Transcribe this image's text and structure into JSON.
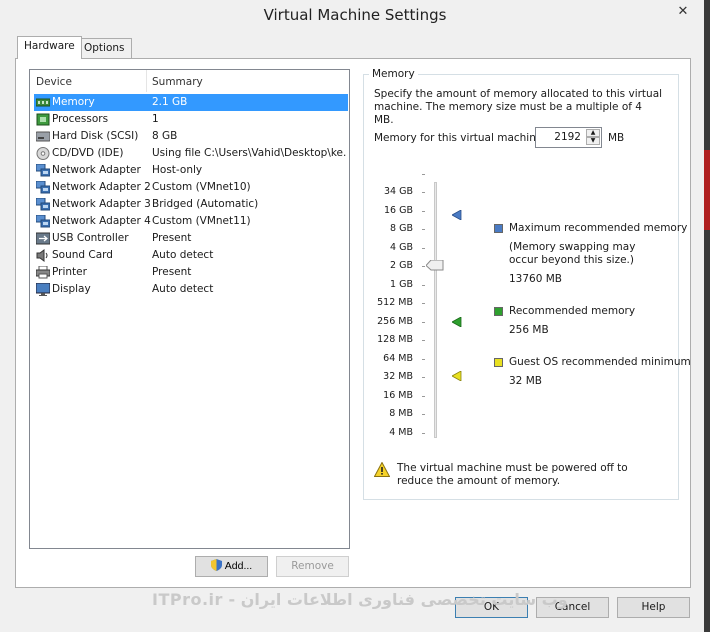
{
  "window": {
    "title": "Virtual Machine Settings",
    "close_glyph": "✕"
  },
  "tabs": [
    {
      "label": "Hardware",
      "active": true
    },
    {
      "label": "Options",
      "active": false
    }
  ],
  "device_table": {
    "headers": {
      "device": "Device",
      "summary": "Summary"
    },
    "rows": [
      {
        "name": "Memory",
        "summary": "2.1 GB",
        "icon": "memory-icon",
        "selected": true
      },
      {
        "name": "Processors",
        "summary": "1",
        "icon": "cpu-icon"
      },
      {
        "name": "Hard Disk (SCSI)",
        "summary": "8 GB",
        "icon": "hard-disk-icon"
      },
      {
        "name": "CD/DVD (IDE)",
        "summary": "Using file C:\\Users\\Vahid\\Desktop\\ke...",
        "icon": "cd-dvd-icon"
      },
      {
        "name": "Network Adapter",
        "summary": "Host-only",
        "icon": "network-adapter-icon"
      },
      {
        "name": "Network Adapter 2",
        "summary": "Custom (VMnet10)",
        "icon": "network-adapter-icon"
      },
      {
        "name": "Network Adapter 3",
        "summary": "Bridged (Automatic)",
        "icon": "network-adapter-icon"
      },
      {
        "name": "Network Adapter 4",
        "summary": "Custom (VMnet11)",
        "icon": "network-adapter-icon"
      },
      {
        "name": "USB Controller",
        "summary": "Present",
        "icon": "usb-icon"
      },
      {
        "name": "Sound Card",
        "summary": "Auto detect",
        "icon": "sound-icon"
      },
      {
        "name": "Printer",
        "summary": "Present",
        "icon": "printer-icon"
      },
      {
        "name": "Display",
        "summary": "Auto detect",
        "icon": "display-icon"
      }
    ]
  },
  "buttons": {
    "add": "Add...",
    "remove": "Remove",
    "ok": "OK",
    "cancel": "Cancel",
    "help": "Help"
  },
  "memory": {
    "group_title": "Memory",
    "description": "Specify the amount of memory allocated to this virtual machine. The memory size must be a multiple of 4 MB.",
    "field_label": "Memory for this virtual machine:",
    "value": "2192",
    "unit": "MB",
    "scale": [
      "34 GB",
      "16 GB",
      "8 GB",
      "4 GB",
      "2 GB",
      "1 GB",
      "512 MB",
      "256 MB",
      "128 MB",
      "64 MB",
      "32 MB",
      "16 MB",
      "8 MB",
      "4 MB"
    ],
    "legend": {
      "max_title": "Maximum recommended memory",
      "max_note": "(Memory swapping may occur beyond this size.)",
      "max_value": "13760 MB",
      "rec_title": "Recommended memory",
      "rec_value": "256 MB",
      "min_title": "Guest OS recommended minimum",
      "min_value": "32 MB"
    },
    "colors": {
      "max": "#4a7bc4",
      "rec": "#2ea02e",
      "min": "#e8e020"
    },
    "warning": "The virtual machine must be powered off to reduce the amount of memory."
  },
  "watermark": "وب سایت تخصصی فناوری اطلاعات ایران - ITPro.ir"
}
